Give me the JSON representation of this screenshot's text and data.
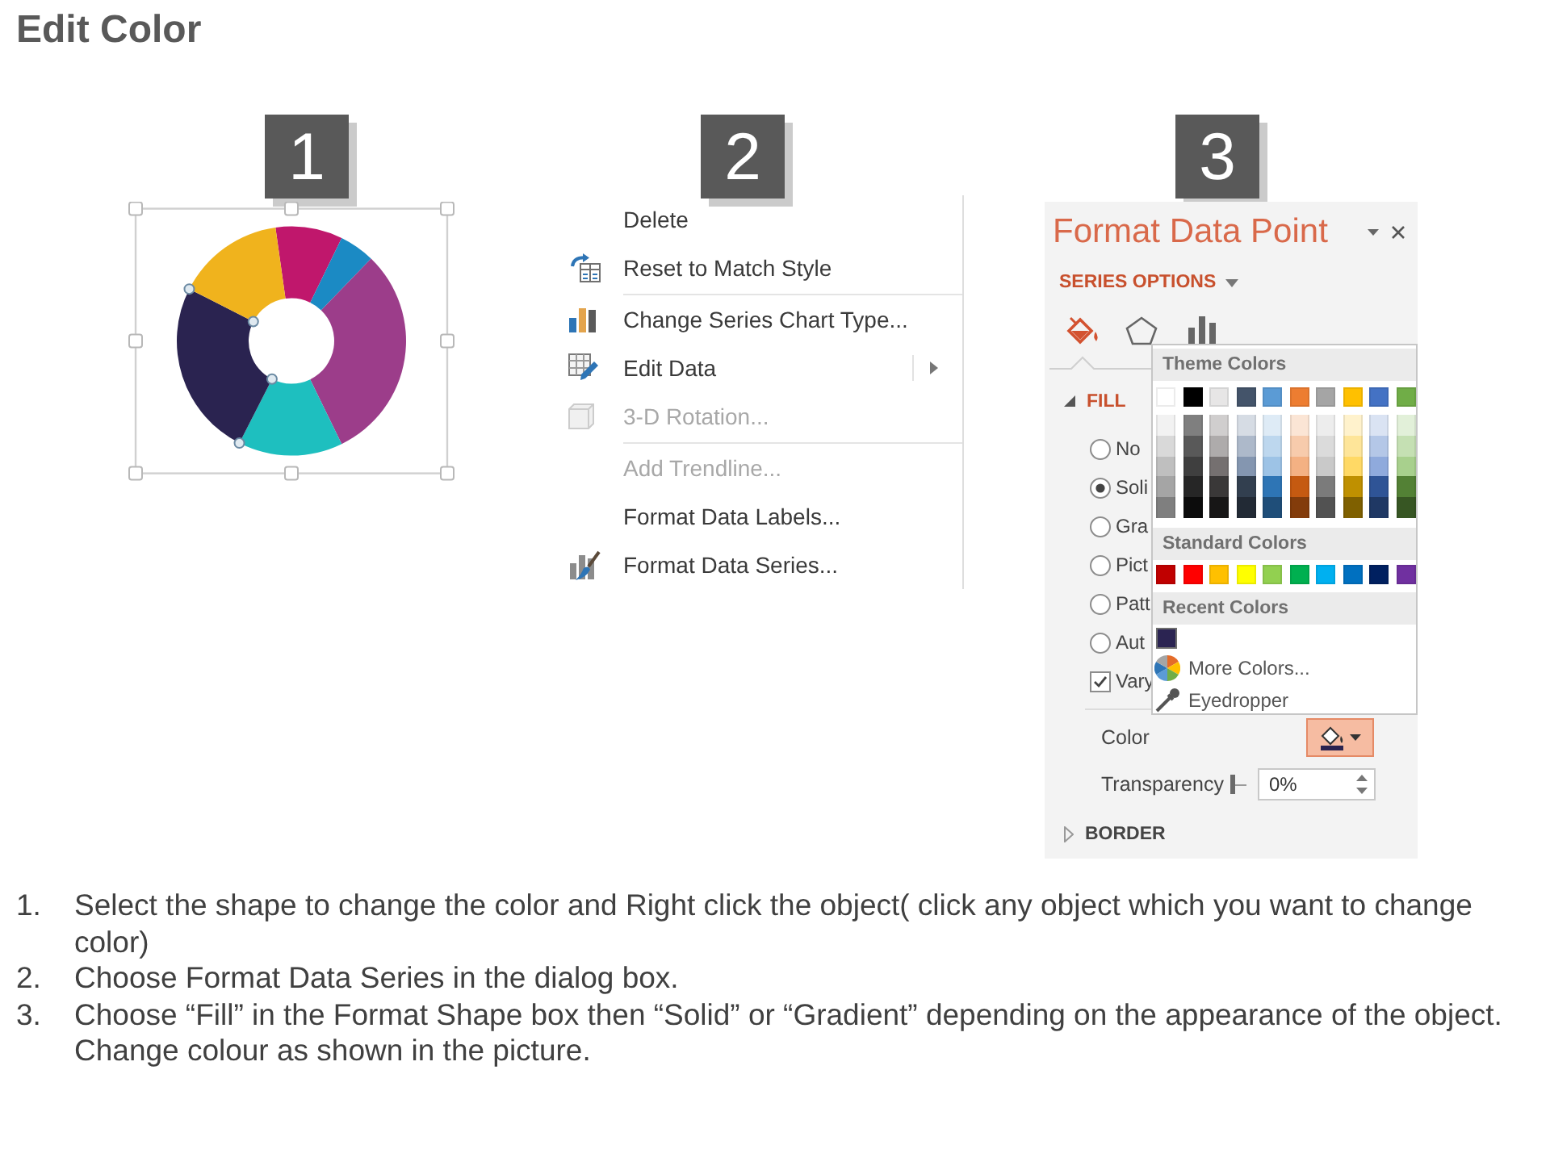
{
  "title": "Edit Color",
  "steps": [
    {
      "badge": "1"
    },
    {
      "badge": "2"
    },
    {
      "badge": "3"
    }
  ],
  "context_menu": {
    "items": [
      {
        "kind": "item",
        "label": "Delete",
        "disabled": false,
        "submenu": false
      },
      {
        "kind": "item",
        "label": "Reset to Match Style",
        "disabled": false,
        "submenu": false
      },
      {
        "kind": "separator"
      },
      {
        "kind": "item",
        "label": "Change Series Chart Type...",
        "disabled": false,
        "submenu": false
      },
      {
        "kind": "item",
        "label": "Edit Data",
        "disabled": false,
        "submenu": true
      },
      {
        "kind": "item",
        "label": "3-D Rotation...",
        "disabled": true,
        "submenu": false
      },
      {
        "kind": "separator"
      },
      {
        "kind": "item",
        "label": "Add Trendline...",
        "disabled": true,
        "submenu": false
      },
      {
        "kind": "item",
        "label": "Format Data Labels...",
        "disabled": false,
        "submenu": false
      },
      {
        "kind": "item",
        "label": "Format Data Series...",
        "disabled": false,
        "submenu": false
      }
    ]
  },
  "format_pane": {
    "title": "Format Data Point",
    "section_menu": "SERIES OPTIONS",
    "tabs": [
      {
        "selected": true
      },
      {
        "selected": false
      },
      {
        "selected": false
      }
    ],
    "fill": {
      "label": "FILL",
      "expanded": true,
      "options": [
        {
          "kind": "radio",
          "label": "No",
          "selected": false
        },
        {
          "kind": "radio",
          "label": "Soli",
          "selected": true
        },
        {
          "kind": "radio",
          "label": "Gra",
          "selected": false
        },
        {
          "kind": "radio",
          "label": "Pict",
          "selected": false
        },
        {
          "kind": "radio",
          "label": "Patt",
          "selected": false
        },
        {
          "kind": "radio",
          "label": "Aut",
          "selected": false
        },
        {
          "kind": "checkbox",
          "label": "Vary",
          "checked": true
        }
      ]
    },
    "color": {
      "label": "Color"
    },
    "transparency": {
      "label": "Transparency",
      "level": 0,
      "value": "0%"
    },
    "border": {
      "label": "BORDER",
      "expanded": false
    },
    "color_menu": {
      "theme_header": "Theme Colors",
      "theme_colors": [
        [
          {
            "color": "#ffffff"
          },
          {
            "color": "#000000"
          },
          {
            "color": "#e7e6e6"
          },
          {
            "color": "#44546a"
          },
          {
            "color": "#5b9bd5"
          },
          {
            "color": "#ed7d31"
          },
          {
            "color": "#a5a5a5"
          },
          {
            "color": "#ffc000"
          },
          {
            "color": "#4472c4"
          },
          {
            "color": "#70ad47"
          }
        ],
        [
          {
            "color": "#f2f2f2"
          },
          {
            "color": "#7f7f7f"
          },
          {
            "color": "#d0cece"
          },
          {
            "color": "#d6dce4"
          },
          {
            "color": "#deebf6"
          },
          {
            "color": "#fbe5d5"
          },
          {
            "color": "#ededed"
          },
          {
            "color": "#fff2cc"
          },
          {
            "color": "#dae3f3"
          },
          {
            "color": "#e2f0d9"
          }
        ],
        [
          {
            "color": "#d9d9d9"
          },
          {
            "color": "#595959"
          },
          {
            "color": "#aeabab"
          },
          {
            "color": "#adb9ca"
          },
          {
            "color": "#bdd7ee"
          },
          {
            "color": "#f7cbac"
          },
          {
            "color": "#dbdbdb"
          },
          {
            "color": "#fee599"
          },
          {
            "color": "#b4c7e7"
          },
          {
            "color": "#c5e0b3"
          }
        ],
        [
          {
            "color": "#bfbfbf"
          },
          {
            "color": "#3f3f3f"
          },
          {
            "color": "#757070"
          },
          {
            "color": "#8496b0"
          },
          {
            "color": "#9dc3e6"
          },
          {
            "color": "#f4b183"
          },
          {
            "color": "#c9c9c9"
          },
          {
            "color": "#ffd965"
          },
          {
            "color": "#8faadc"
          },
          {
            "color": "#a8d08d"
          }
        ],
        [
          {
            "color": "#a5a5a5"
          },
          {
            "color": "#262626"
          },
          {
            "color": "#3a3838"
          },
          {
            "color": "#323f4f"
          },
          {
            "color": "#2e75b5"
          },
          {
            "color": "#c55a11"
          },
          {
            "color": "#7b7b7b"
          },
          {
            "color": "#bf9000"
          },
          {
            "color": "#2f5496"
          },
          {
            "color": "#538135"
          }
        ],
        [
          {
            "color": "#7f7f7f"
          },
          {
            "color": "#0c0c0c"
          },
          {
            "color": "#171616"
          },
          {
            "color": "#222a35"
          },
          {
            "color": "#1f4e79"
          },
          {
            "color": "#833c0b"
          },
          {
            "color": "#525252"
          },
          {
            "color": "#7f6000"
          },
          {
            "color": "#1f3864"
          },
          {
            "color": "#375623"
          }
        ]
      ],
      "standard_header": "Standard Colors",
      "standard_colors": [
        {
          "color": "#c00000"
        },
        {
          "color": "#ff0000"
        },
        {
          "color": "#ffc000"
        },
        {
          "color": "#ffff00"
        },
        {
          "color": "#92d050"
        },
        {
          "color": "#00b050"
        },
        {
          "color": "#00b0f0"
        },
        {
          "color": "#0070c0"
        },
        {
          "color": "#002060"
        },
        {
          "color": "#7030a0"
        }
      ],
      "recent_header": "Recent Colors",
      "recent_colors": [
        {
          "color": "#2b2452"
        }
      ],
      "actions": [
        {
          "label": "More Colors..."
        },
        {
          "label": "Eyedropper"
        }
      ]
    }
  },
  "instructions": [
    {
      "number": "1.",
      "text": "Select the shape to change the color and Right click the object( click any object which you want to change color)"
    },
    {
      "number": "2.",
      "text": "Choose Format Data Series in the dialog box."
    },
    {
      "number": "3.",
      "text": "Choose “Fill” in the Format Shape box then “Solid” or “Gradient” depending on the appearance of the object. Change colour as shown in the picture."
    }
  ]
}
